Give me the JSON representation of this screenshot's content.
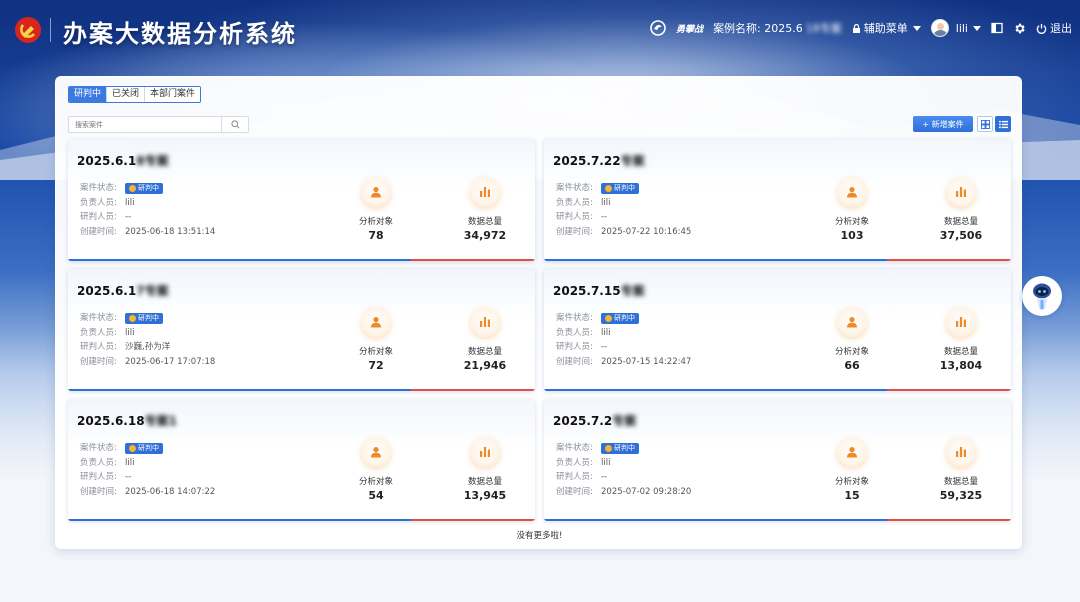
{
  "header": {
    "title": "办案大数据分析系统",
    "case_name_label": "案例名称: 2025.6",
    "case_name_blur": "18专案",
    "assist_menu": "辅助菜单",
    "user": "lili",
    "logout": "退出",
    "brand_text": "勇攀战"
  },
  "tabs": [
    {
      "label": "研判中"
    },
    {
      "label": "已关闭"
    },
    {
      "label": "本部门案件"
    }
  ],
  "search": {
    "placeholder": "搜索案件"
  },
  "toolbar": {
    "add_label": "+ 新增案件"
  },
  "labels": {
    "status": "案件状态:",
    "owner": "负责人员:",
    "analyst": "研判人员:",
    "created": "创建时间:",
    "stat_objects": "分析对象",
    "stat_total": "数据总量"
  },
  "cards": [
    {
      "title": "2025.6.1",
      "title_blur": "8专案",
      "status": "研判中",
      "owner": "lili",
      "analyst": "--",
      "created": "2025-06-18 13:51:14",
      "objects": "78",
      "total": "34,972"
    },
    {
      "title": "2025.7.22",
      "title_blur": "专案",
      "status": "研判中",
      "owner": "lili",
      "analyst": "--",
      "created": "2025-07-22 10:16:45",
      "objects": "103",
      "total": "37,506"
    },
    {
      "title": "2025.6.1",
      "title_blur": "7专案",
      "status": "研判中",
      "owner": "lili",
      "analyst": "沙巍,孙为洋",
      "created": "2025-06-17 17:07:18",
      "objects": "72",
      "total": "21,946"
    },
    {
      "title": "2025.7.15",
      "title_blur": "专案",
      "status": "研判中",
      "owner": "lili",
      "analyst": "--",
      "created": "2025-07-15 14:22:47",
      "objects": "66",
      "total": "13,804"
    },
    {
      "title": "2025.6.18",
      "title_blur": "专案1",
      "status": "研判中",
      "owner": "lili",
      "analyst": "--",
      "created": "2025-06-18 14:07:22",
      "objects": "54",
      "total": "13,945"
    },
    {
      "title": "2025.7.2",
      "title_blur": "专案",
      "status": "研判中",
      "owner": "lili",
      "analyst": "--",
      "created": "2025-07-02 09:28:20",
      "objects": "15",
      "total": "59,325"
    }
  ],
  "footer": {
    "no_more": "没有更多啦!"
  },
  "colors": {
    "accent": "#2f6fd8",
    "danger": "#e0504a",
    "orange": "#f08a28"
  }
}
